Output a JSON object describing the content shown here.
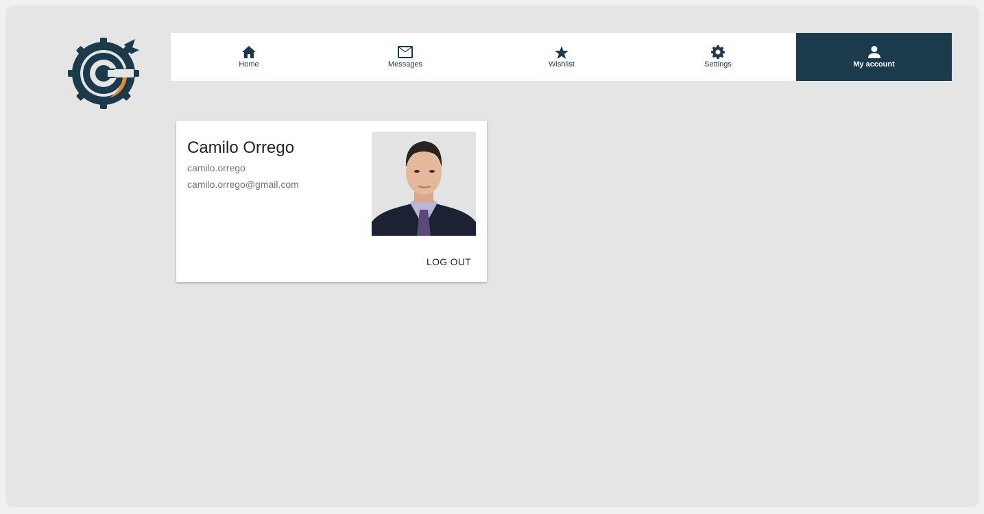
{
  "nav": {
    "items": [
      {
        "label": "Home",
        "icon": "home-icon"
      },
      {
        "label": "Messages",
        "icon": "mail-icon"
      },
      {
        "label": "Wishlist",
        "icon": "star-icon"
      },
      {
        "label": "Settings",
        "icon": "gear-icon"
      },
      {
        "label": "My account",
        "icon": "user-icon",
        "active": true
      }
    ]
  },
  "profile": {
    "name": "Camilo Orrego",
    "username": "camilo.orrego",
    "email": "camilo.orrego@gmail.com",
    "logout_label": "LOG OUT"
  },
  "colors": {
    "primary": "#1b3a4b",
    "accent": "#e88a2d",
    "background": "#e5e5e5"
  }
}
